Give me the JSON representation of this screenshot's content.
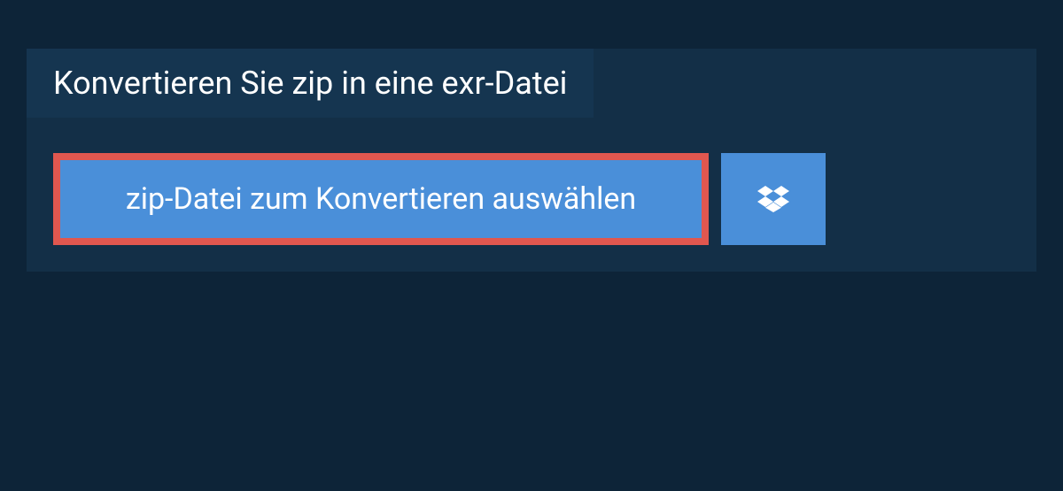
{
  "title": "Konvertieren Sie zip in eine exr-Datei",
  "choose_button_label": "zip-Datei zum Konvertieren auswählen",
  "colors": {
    "background": "#0d2438",
    "panel": "#132f47",
    "title_bar": "#153550",
    "button": "#4a8fd9",
    "highlight_border": "#e0574f"
  }
}
